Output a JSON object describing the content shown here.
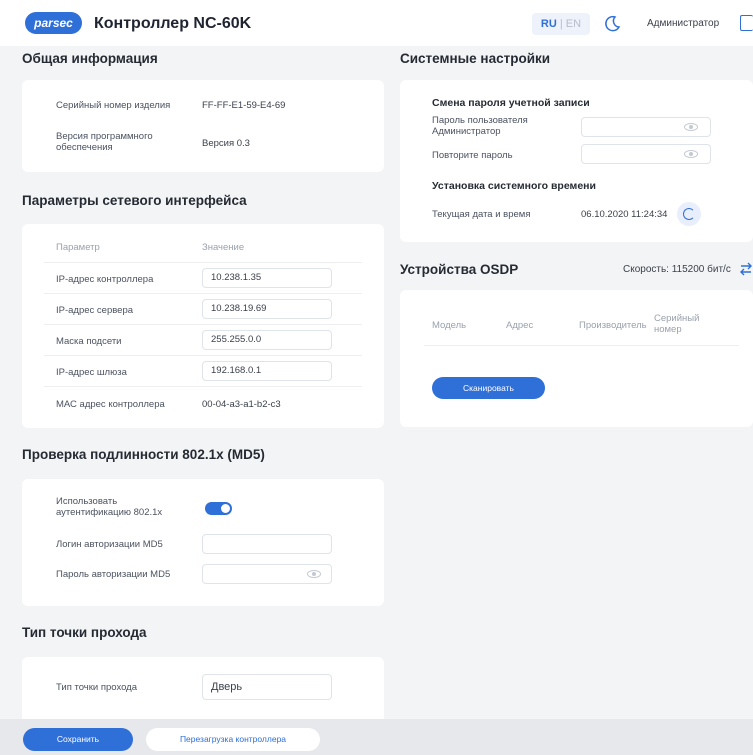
{
  "header": {
    "logo": "parsec",
    "title": "Контроллер NC-60K",
    "lang_ru": "RU",
    "lang_sep": "|",
    "lang_en": "EN",
    "theme_icon": "moon-icon",
    "user": "Администратор",
    "logout_icon": "door-icon"
  },
  "general": {
    "title": "Общая информация",
    "serial_label": "Серийный номер изделия",
    "serial_value": "FF-FF-E1-59-E4-69",
    "firmware_label": "Версия программного обеспечения",
    "firmware_value": "Версия 0.3"
  },
  "network": {
    "title": "Параметры сетевого интерфейса",
    "col_param": "Параметр",
    "col_value": "Значение",
    "rows": [
      {
        "label": "IP-адрес контроллера",
        "value": "10.238.1.35"
      },
      {
        "label": "IP-адрес сервера",
        "value": "10.238.19.69"
      },
      {
        "label": "Маска подсети",
        "value": "255.255.0.0"
      },
      {
        "label": "IP-адрес шлюза",
        "value": "192.168.0.1"
      }
    ],
    "mac_label": "МАС адрес контроллера",
    "mac_value": "00-04-a3-a1-b2-c3"
  },
  "auth": {
    "title": "Проверка подлинности 802.1x (MD5)",
    "use_label": "Использовать аутентификацию 802.1x",
    "use_enabled": true,
    "login_label": "Логин авторизации MD5",
    "login_value": "",
    "password_label": "Пароль авторизации MD5",
    "password_value": ""
  },
  "passage": {
    "title": "Тип точки прохода",
    "type_label": "Тип точки прохода",
    "type_value": "Дверь"
  },
  "system": {
    "title": "Системные настройки",
    "password_heading": "Смена пароля учетной записи",
    "admin_pw_label": "Пароль пользователя Администратор",
    "repeat_pw_label": "Повторите пароль",
    "time_heading": "Установка системного времени",
    "datetime_label": "Текущая дата и время",
    "datetime_value": "06.10.2020 11:24:34"
  },
  "osdp": {
    "title": "Устройства OSDP",
    "speed": "Скорость: 115200 бит/с",
    "columns": [
      "Модель",
      "Адрес",
      "Производитель",
      "Серийный номер"
    ],
    "scan_label": "Сканировать"
  },
  "footer": {
    "save_label": "Сохранить",
    "reboot_label": "Перезагрузка контроллера"
  },
  "colors": {
    "accent": "#2f6fd8",
    "background": "#f3f4f6",
    "card": "#ffffff"
  }
}
